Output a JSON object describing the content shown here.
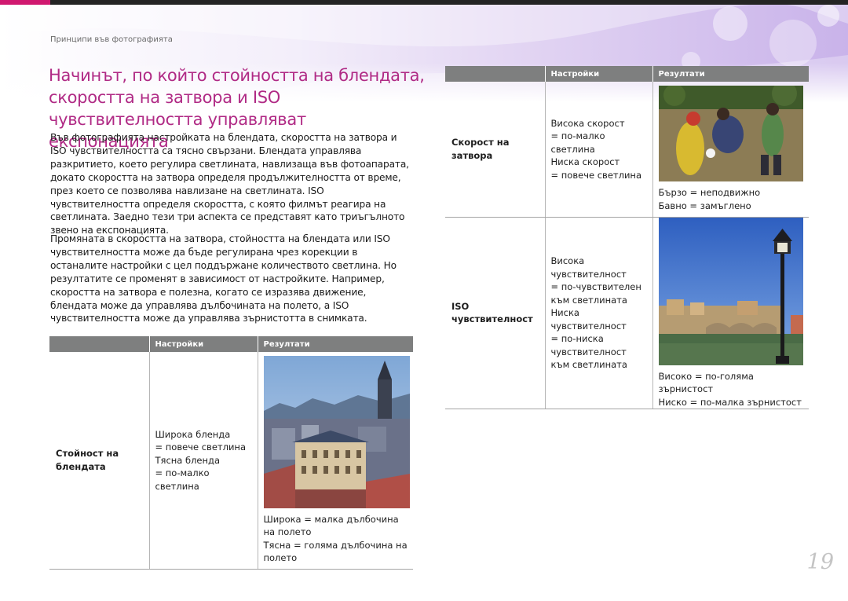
{
  "breadcrumb": "Принципи във фотографията",
  "title": "Начинът, по който стойността на блендата, скоростта на затвора и ISO чувствителността управляват експонацията",
  "paragraphs": [
    "Във фотографията настройката на блендата, скоростта на затвора и ISO чувствителността са тясно свързани. Блендата управлява разкритието, което регулира светлината, навлизаща във фотоапарата, докато скоростта на затвора определя продължителността от време, през което се позволява навлизане на светлината. ISO чувствителността определя скоростта, с която филмът реагира на светлината. Заедно тези три аспекта се представят като триъгълното звено на експонацията.",
    "Промяната в скоростта на затвора, стойността на блендата или ISO чувствителността може да бъде регулирана чрез корекции в останалите настройки с цел поддържане количеството светлина. Но резултатите се променят в зависимост от настройките. Например, скоростта на затвора е полезна, когато се изразява движение, блендата може да управлява дълбочината на полето, а ISO чувствителността може да управлява зърнистотта в снимката."
  ],
  "table_headers": {
    "settings": "Настройки",
    "results": "Резултати"
  },
  "aperture_row": {
    "param": "Стойност на\nблендата",
    "settings": "Широка бленда\n= повече светлина\nТясна бленда\n= по-малко\nсветлина",
    "result": "Широка = малка дълбочина\nна полето\nТясна = голяма дълбочина на\nполето"
  },
  "speed_row": {
    "param": "Скорост на\nзатвора",
    "settings": "Висока скорост\n= по-малко\nсветлина\nНиска скорост\n= повече светлина",
    "result": "Бързо = неподвижно\nБавно = замъглено"
  },
  "iso_row": {
    "param": "ISO\nчувствителност",
    "settings": "Висока\nчувствителност\n= по-чувствителен\nкъм светлината\nНиска\nчувствителност\n= по-ниска\nчувствителност\nкъм светлината",
    "result": "Високо = по-голяма зърнистост\nНиско = по-малка зърнистост"
  },
  "page_number": "19"
}
